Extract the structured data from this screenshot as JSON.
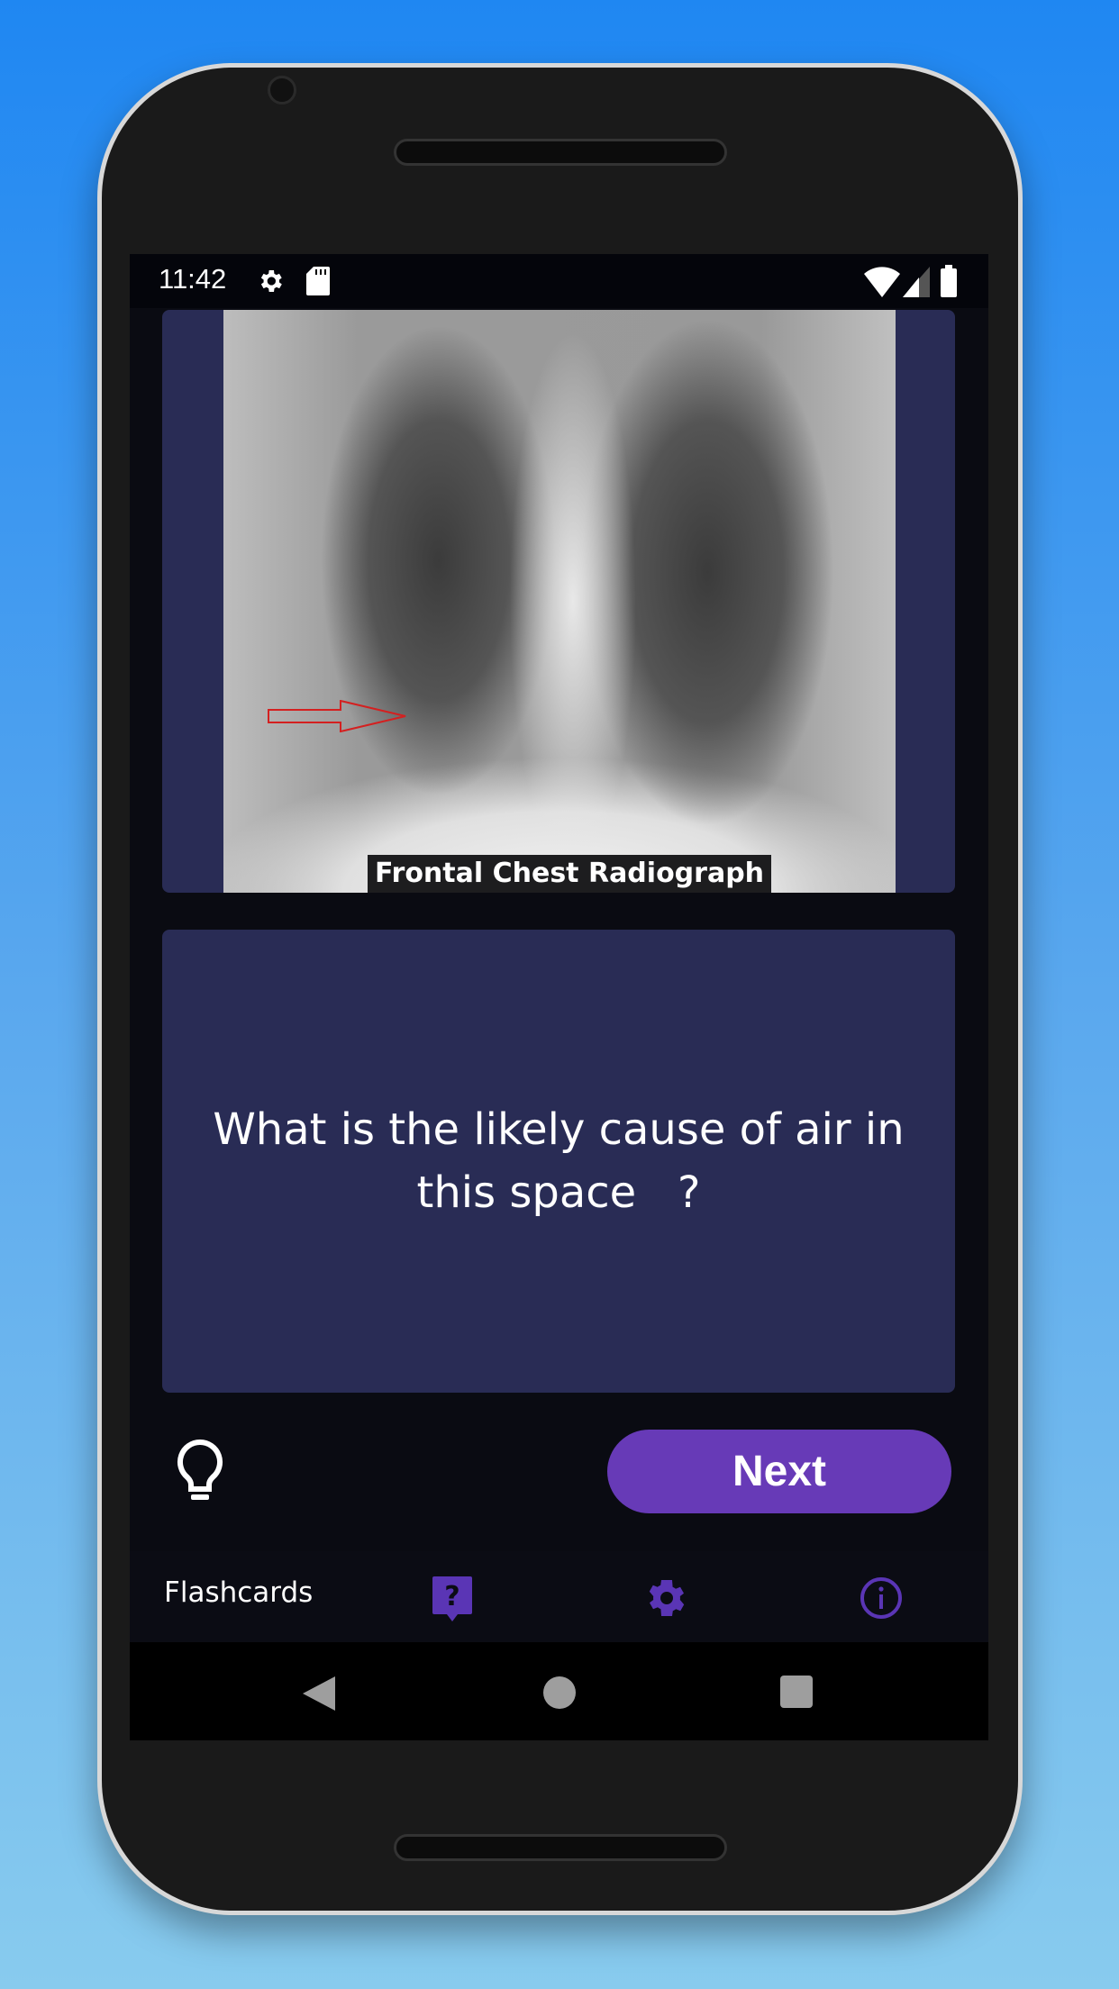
{
  "status_bar": {
    "time": "11:42",
    "left_icons": [
      "gear-icon",
      "sd-card-icon"
    ],
    "right_icons": [
      "wifi-icon",
      "signal-icon",
      "battery-icon"
    ]
  },
  "image_card": {
    "caption": "Frontal Chest Radiograph",
    "image": "chest-xray-with-red-arrow"
  },
  "question_card": {
    "text": "What is the likely cause of air in this space   ?"
  },
  "actions": {
    "hint_icon": "lightbulb-icon",
    "next_label": "Next",
    "accent": "#673ab7"
  },
  "bottom_nav": {
    "label": "Flashcards",
    "icons": [
      "question-bubble-icon",
      "settings-gear-icon",
      "info-icon"
    ],
    "icon_color": "#5a35b5"
  },
  "system_nav": [
    "back-icon",
    "home-icon",
    "recents-icon"
  ]
}
